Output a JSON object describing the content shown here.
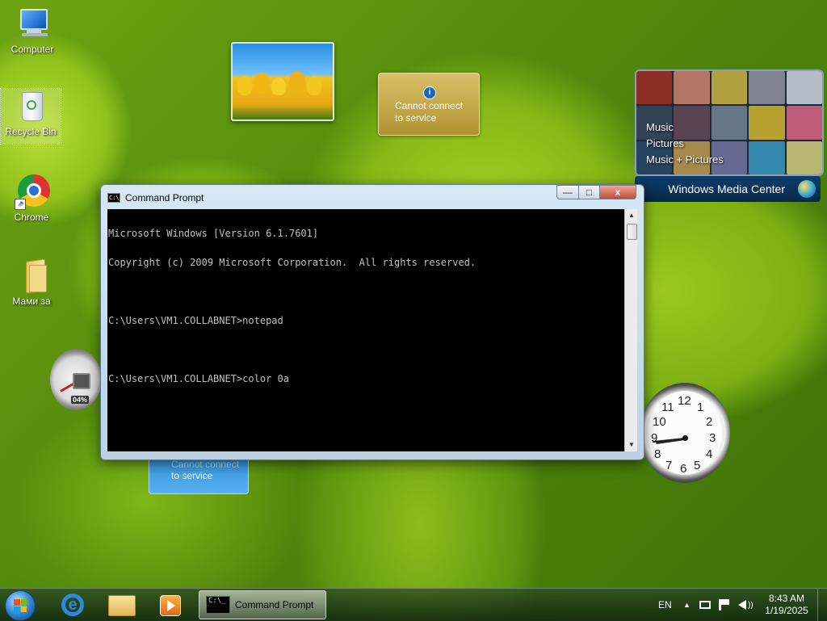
{
  "desktop": {
    "icons": [
      {
        "label": "Computer",
        "icon": "computer-icon"
      },
      {
        "label": "Recycle Bin",
        "icon": "recycle-bin-icon"
      },
      {
        "label": "Chrome",
        "icon": "chrome-icon"
      },
      {
        "label": "Мами за",
        "icon": "folder-icon"
      }
    ]
  },
  "gadgets": {
    "weather": {
      "text_line1": "Cannot connect",
      "text_line2": "to service"
    },
    "weather2": {
      "text_line1": "Cannot connect",
      "text_line2": "to service"
    },
    "cpu": {
      "percent_label": "04%"
    },
    "media_center": {
      "menu": [
        "Music",
        "Pictures",
        "Music + Pictures"
      ],
      "title": "Windows Media Center"
    },
    "clock": {
      "numbers": [
        "12",
        "1",
        "2",
        "3",
        "4",
        "5",
        "6",
        "7",
        "8",
        "9",
        "10",
        "11"
      ]
    }
  },
  "cmd_window": {
    "title": "Command Prompt",
    "icon_text": "C:\\_",
    "min_label": "—",
    "max_label": "□",
    "close_label": "x",
    "lines": [
      "Microsoft Windows [Version 6.1.7601]",
      "Copyright (c) 2009 Microsoft Corporation.  All rights reserved.",
      "",
      "C:\\Users\\VM1.COLLABNET>notepad",
      "",
      "C:\\Users\\VM1.COLLABNET>color 0a"
    ]
  },
  "taskbar": {
    "active_task_label": "Command Prompt",
    "active_task_icon_text": "C:\\_",
    "language": "EN",
    "time": "8:43 AM",
    "date": "1/19/2025"
  },
  "colors": {
    "console_bg": "#000000",
    "console_text": "#c0c0c0",
    "close_button": "#c44a35"
  }
}
